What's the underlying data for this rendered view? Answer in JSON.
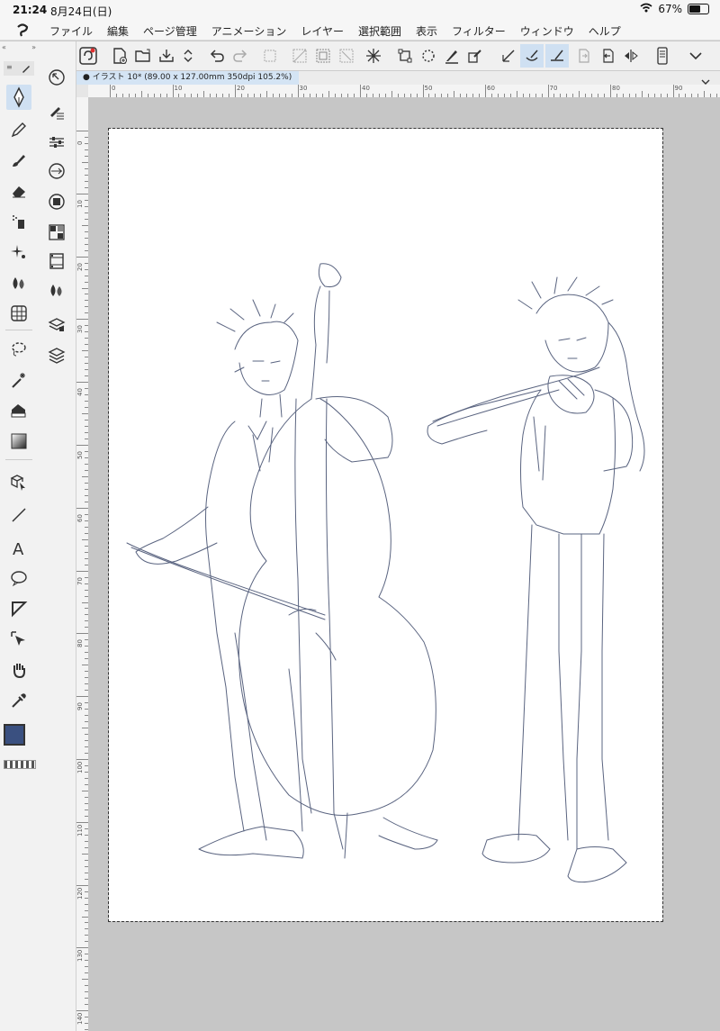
{
  "status": {
    "time": "21:24",
    "date": "8月24日(日)",
    "battery": "67%",
    "battery_fraction": 0.67
  },
  "menu": [
    "ファイル",
    "編集",
    "ページ管理",
    "アニメーション",
    "レイヤー",
    "選択範囲",
    "表示",
    "フィルター",
    "ウィンドウ",
    "ヘルプ"
  ],
  "document": {
    "tab_title": "イラスト 10* (89.00 x 127.00mm 350dpi 105.2%)"
  },
  "ruler": {
    "h": [
      "0",
      "10",
      "20",
      "30",
      "40",
      "50",
      "60",
      "70",
      "80",
      "90"
    ],
    "v": [
      "0",
      "10",
      "20",
      "30",
      "40",
      "50",
      "60",
      "70",
      "80",
      "90",
      "100",
      "110",
      "120",
      "130",
      "140"
    ]
  },
  "colors": {
    "main": "#3a5080",
    "sub": "#ffffff",
    "line": "#5a6480",
    "selected": "#cfe0f2"
  }
}
